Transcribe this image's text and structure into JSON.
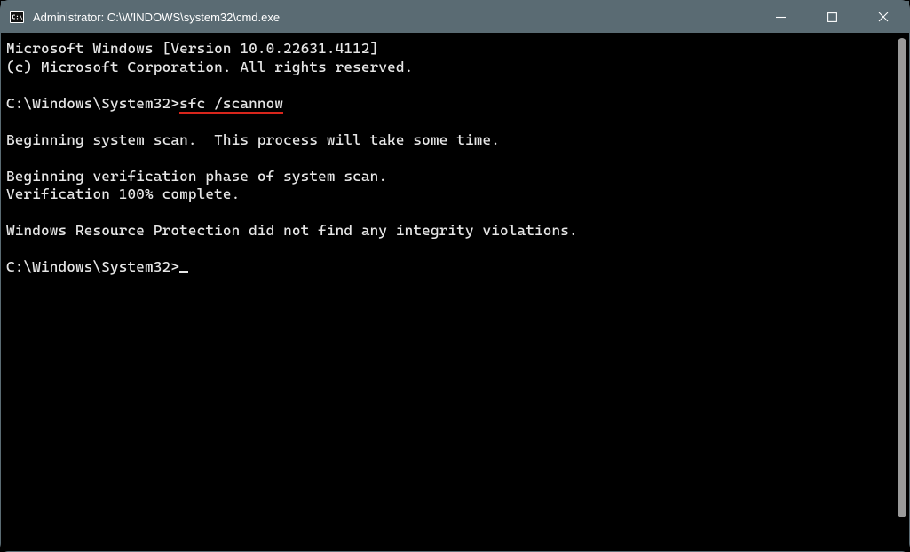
{
  "window": {
    "title": "Administrator: C:\\WINDOWS\\system32\\cmd.exe"
  },
  "terminal": {
    "line1": "Microsoft Windows [Version 10.0.22631.4112]",
    "line2": "(c) Microsoft Corporation. All rights reserved.",
    "prompt1_prefix": "C:\\Windows\\System32>",
    "command1": "sfc /scannow",
    "line_begin_scan": "Beginning system scan.  This process will take some time.",
    "line_verify_phase": "Beginning verification phase of system scan.",
    "line_verify_done": "Verification 100% complete.",
    "line_result": "Windows Resource Protection did not find any integrity violations.",
    "prompt2_prefix": "C:\\Windows\\System32>"
  }
}
